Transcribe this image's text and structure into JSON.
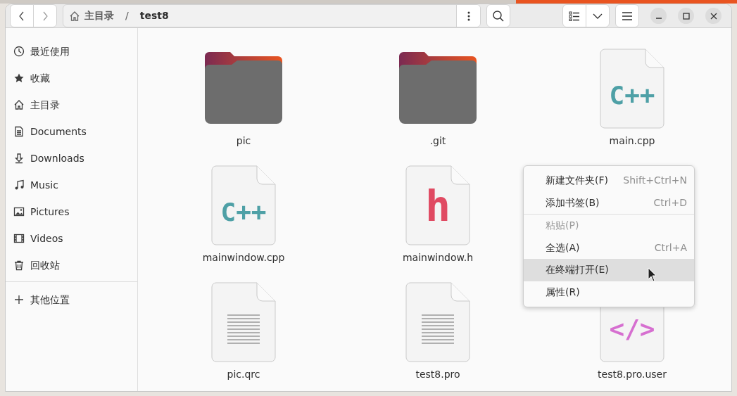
{
  "path": [
    {
      "label": "主目录",
      "kind": "home"
    },
    {
      "label": "test8",
      "kind": "current"
    }
  ],
  "path_separator": "/",
  "sidebar": {
    "places": [
      {
        "label": "最近使用",
        "kind": "recent"
      },
      {
        "label": "收藏",
        "kind": "starred"
      },
      {
        "label": "主目录",
        "kind": "home"
      },
      {
        "label": "Documents",
        "kind": "documents"
      },
      {
        "label": "Downloads",
        "kind": "downloads"
      },
      {
        "label": "Music",
        "kind": "music"
      },
      {
        "label": "Pictures",
        "kind": "pictures"
      },
      {
        "label": "Videos",
        "kind": "videos"
      },
      {
        "label": "回收站",
        "kind": "trash"
      }
    ],
    "other": [
      {
        "label": "其他位置",
        "kind": "other"
      }
    ]
  },
  "files": [
    {
      "name": "pic",
      "kind": "folder"
    },
    {
      "name": ".git",
      "kind": "folder"
    },
    {
      "name": "main.cpp",
      "kind": "glyph",
      "glyph": "C++",
      "color": "#4ea0a6"
    },
    {
      "name": "mainwindow.cpp",
      "kind": "glyph",
      "glyph": "C++",
      "color": "#4ea0a6"
    },
    {
      "name": "mainwindow.h",
      "kind": "glyph",
      "glyph": "h",
      "color": "#e04a62"
    },
    {
      "name": "pic.qrc",
      "kind": "text"
    },
    {
      "name": "test8.pro",
      "kind": "text"
    },
    {
      "name": "test8.pro.user",
      "kind": "glyph",
      "glyph": "</>",
      "color": "#d66fd0"
    }
  ],
  "context_menu": [
    {
      "label": "新建文件夹(F)",
      "shortcut": "Shift+Ctrl+N",
      "disabled": false,
      "highlighted": false,
      "separator_after": false
    },
    {
      "label": "添加书签(B)",
      "shortcut": "Ctrl+D",
      "disabled": false,
      "highlighted": false,
      "separator_after": true
    },
    {
      "label": "粘贴(P)",
      "disabled": true,
      "highlighted": false,
      "separator_after": false
    },
    {
      "label": "全选(A)",
      "shortcut": "Ctrl+A",
      "disabled": false,
      "highlighted": false,
      "separator_after": false
    },
    {
      "label": "在终端打开(E)",
      "disabled": false,
      "highlighted": true,
      "separator_after": false
    },
    {
      "label": "属性(R)",
      "disabled": false,
      "highlighted": false,
      "separator_after": false
    }
  ]
}
